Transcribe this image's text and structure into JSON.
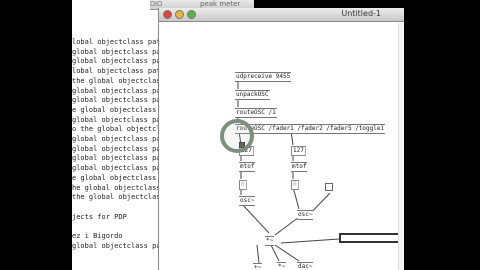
{
  "console": {
    "header": "DIO",
    "lines": [
      "lobal objectclass path",
      "global objectclass path",
      "global objectclass pat",
      "lobal objectclass path",
      "the global objectclass",
      "global objectclass path",
      "global objectclass pat",
      "e global objectclass p",
      "global objectclass pat",
      "o the global objectcla",
      "global objectclass path",
      "global objectclass pat",
      "global objectclass path",
      "global objectclass pat",
      "e global objectclass p",
      "he global objectclass",
      "the global objectclass",
      "",
      "jects for PDP",
      "",
      "ez i Bigordo",
      "global objectclass path"
    ]
  },
  "bg_window": {
    "title": "peak meter"
  },
  "patch_window": {
    "title": "Untitled-1",
    "objects": {
      "udpreceive": "udpreceive 9455",
      "unpack": "unpackOSC",
      "route1": "routeOSC /1",
      "route_faders": "routeOSC /fader1 /fader2 /fader5 /toggle1",
      "num_left": "127",
      "num_right": "127",
      "mtof_left": "mtof",
      "mtof_right": "mtof",
      "osc_left": "osc~",
      "osc_right": "osc~",
      "mult_left": "*~",
      "mult_right": "*~",
      "plus": "+~",
      "dac": "dac~",
      "zero_left": "0",
      "zero_right": "0"
    }
  }
}
